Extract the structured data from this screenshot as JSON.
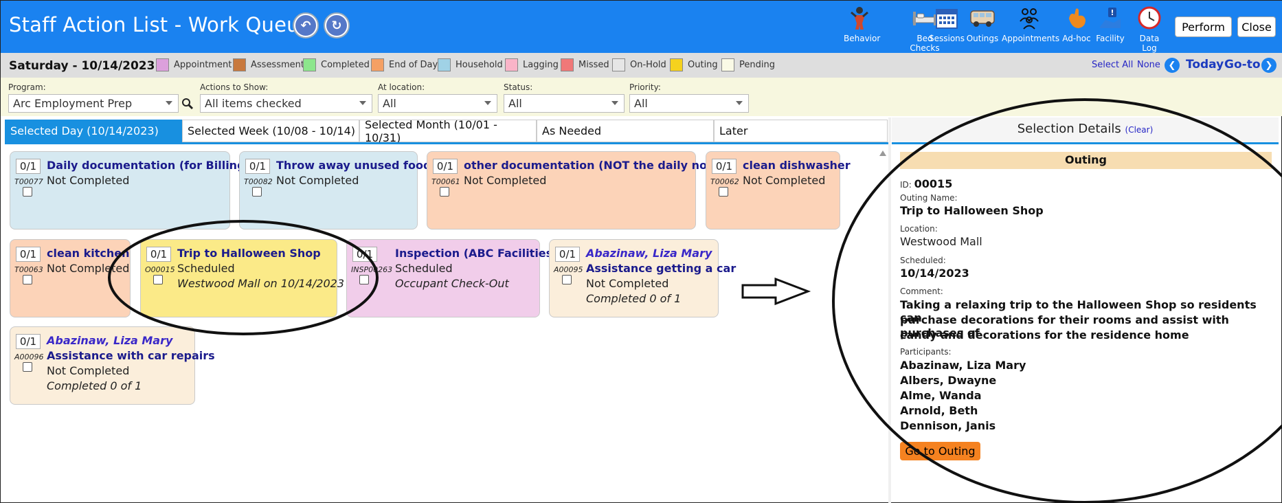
{
  "header": {
    "title": "Staff Action List - Work Queue",
    "tools": [
      {
        "label": "Behavior",
        "icon": "behavior-icon"
      },
      {
        "label": "Bed Checks",
        "icon": "bed-icon"
      },
      {
        "label": "Sessions",
        "icon": "calendar-icon"
      },
      {
        "label": "Outings",
        "icon": "van-icon"
      },
      {
        "label": "Appointments",
        "icon": "people-icon"
      },
      {
        "label": "Ad-hoc",
        "icon": "hand-icon"
      },
      {
        "label": "Facility",
        "icon": "facility-alert-icon"
      },
      {
        "label": "Data Log",
        "icon": "clock-icon"
      }
    ],
    "perform": "Perform",
    "close": "Close"
  },
  "datebar": {
    "date": "Saturday - 10/14/2023",
    "legend": [
      {
        "label": "Appointment",
        "color": "#dca0dc"
      },
      {
        "label": "Assessment",
        "color": "#c8783c"
      },
      {
        "label": "Completed",
        "color": "#8ce68c"
      },
      {
        "label": "End of Day",
        "color": "#f5a064"
      },
      {
        "label": "Household",
        "color": "#a0d2e6"
      },
      {
        "label": "Lagging",
        "color": "#fab4c8"
      },
      {
        "label": "Missed",
        "color": "#f07878"
      },
      {
        "label": "On-Hold",
        "color": "#e6e6e6"
      },
      {
        "label": "Outing",
        "color": "#f5d21e"
      },
      {
        "label": "Pending",
        "color": "#fafae6"
      }
    ],
    "select_all": "Select All",
    "none": "None",
    "today": "Today",
    "goto": "Go-to"
  },
  "filters": {
    "program_label": "Program:",
    "program_value": "Arc Employment Prep",
    "actions_label": "Actions to Show:",
    "actions_value": "All items checked",
    "location_label": "At location:",
    "location_value": "All",
    "status_label": "Status:",
    "status_value": "All",
    "priority_label": "Priority:",
    "priority_value": "All"
  },
  "tabs": [
    "Selected Day (10/14/2023)",
    "Selected Week (10/08 - 10/14)",
    "Selected Month (10/01 - 10/31)",
    "As Needed",
    "Later"
  ],
  "cards": [
    {
      "count": "0/1",
      "code": "T00077",
      "title": "Daily documentation (for Billing)",
      "status": "Not Completed"
    },
    {
      "count": "0/1",
      "code": "T00082",
      "title": "Throw away unused food",
      "status": "Not Completed"
    },
    {
      "count": "0/1",
      "code": "T00061",
      "title": "other documentation (NOT the daily note)",
      "status": "Not Completed"
    },
    {
      "count": "0/1",
      "code": "T00062",
      "title": "clean dishwasher",
      "status": "Not Completed"
    },
    {
      "count": "0/1",
      "code": "T00063",
      "title": "clean kitchen",
      "status": "Not Completed"
    },
    {
      "count": "0/1",
      "code": "O00015",
      "title": "Trip to Halloween Shop",
      "status": "Scheduled",
      "detail": "Westwood Mall on 10/14/2023"
    },
    {
      "count": "0/1",
      "code": "INSP00263",
      "title": "Inspection (ABC Facilities)",
      "status": "Scheduled",
      "detail": "Occupant Check-Out"
    },
    {
      "count": "0/1",
      "code": "A00095",
      "person": "Abazinaw, Liza Mary",
      "title": "Assistance getting a car",
      "status": "Not Completed",
      "detail": "Completed 0 of 1"
    },
    {
      "count": "0/1",
      "code": "A00096",
      "person": "Abazinaw, Liza Mary",
      "title": "Assistance with car repairs",
      "status": "Not Completed",
      "detail": "Completed 0 of 1"
    }
  ],
  "details": {
    "heading": "Selection Details",
    "clear": "(Clear)",
    "type": "Outing",
    "id_label": "ID:",
    "id": "00015",
    "name_label": "Outing Name:",
    "name": "Trip to Halloween Shop",
    "location_label": "Location:",
    "location": "Westwood Mall",
    "scheduled_label": "Scheduled:",
    "scheduled": "10/14/2023",
    "comment_label": "Comment:",
    "comment": [
      "Taking a relaxing trip to the Halloween Shop so residents can",
      "purchase decorations for their rooms and assist with purchases of",
      "candy and decorations for the residence home"
    ],
    "participants_label": "Participants:",
    "participants": [
      "Abazinaw, Liza Mary",
      "Albers, Dwayne",
      "Alme, Wanda",
      "Arnold, Beth",
      "Dennison, Janis"
    ],
    "go_button": "Go to Outing"
  }
}
